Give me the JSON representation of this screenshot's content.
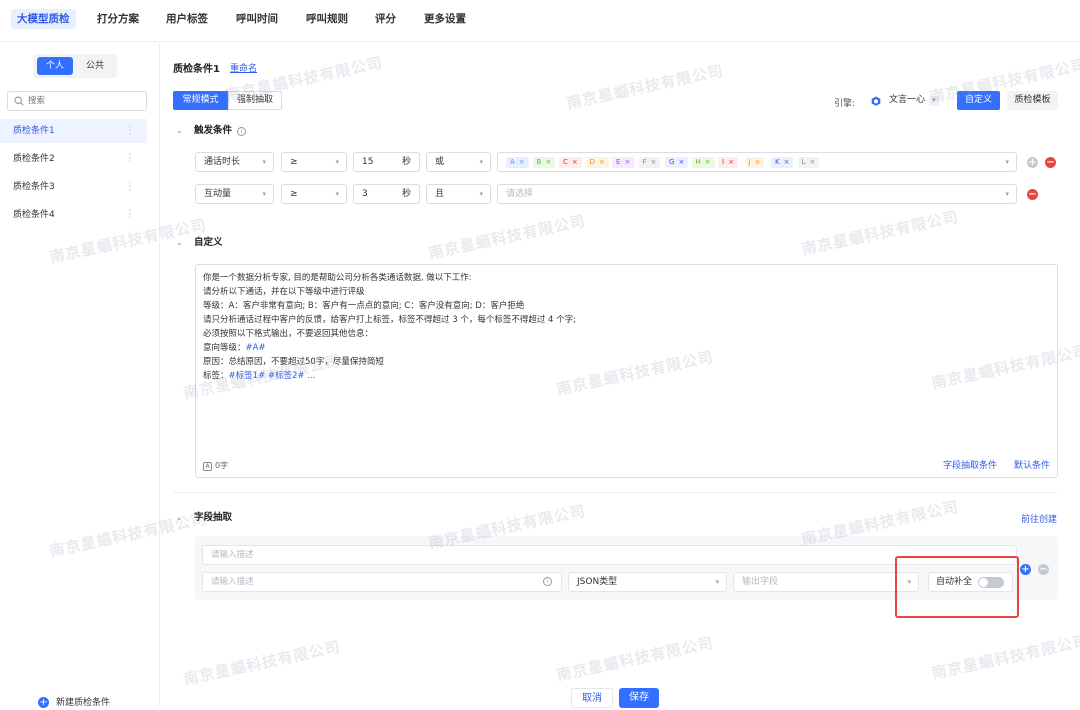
{
  "nav": {
    "tabs": [
      "大模型质检",
      "打分方案",
      "用户标签",
      "呼叫时间",
      "呼叫规则",
      "评分",
      "更多设置"
    ],
    "active": "大模型质检"
  },
  "sidebar": {
    "segments": [
      "个人",
      "公共"
    ],
    "active_segment": "个人",
    "search_placeholder": "搜索",
    "items": [
      {
        "label": "质检条件1",
        "more": "⋮"
      },
      {
        "label": "质检条件2",
        "more": "⋮"
      },
      {
        "label": "质检条件3",
        "more": "⋮"
      },
      {
        "label": "质检条件4",
        "more": "⋮"
      }
    ],
    "active_item": "质检条件1",
    "new_button": "新建质检条件"
  },
  "main": {
    "title": "质检条件1",
    "rename": "重命名",
    "modes": [
      "常规模式",
      "强制抽取"
    ],
    "active_mode": "常规模式",
    "engine_label": "引擎:",
    "engine_value": "文言一心",
    "custom_button": "自定义",
    "template_button": "质检模板"
  },
  "trigger": {
    "title": "触发条件",
    "rows": [
      {
        "field": "通话时长",
        "op": "≥",
        "value": "15",
        "unit": "秒",
        "logic": "或",
        "tags": [
          {
            "label": "A",
            "color": "#5b8ff9",
            "bg": "#e8f0ff"
          },
          {
            "label": "B",
            "color": "#52c41a",
            "bg": "#eaf8e4"
          },
          {
            "label": "C",
            "color": "#f5222d",
            "bg": "#ffecec"
          },
          {
            "label": "D",
            "color": "#fa8c16",
            "bg": "#fff3e3"
          },
          {
            "label": "E",
            "color": "#9254de",
            "bg": "#f3ecff"
          },
          {
            "label": "F",
            "color": "#8c8c8c",
            "bg": "#f2f2f2"
          },
          {
            "label": "G",
            "color": "#2f54eb",
            "bg": "#ebefff"
          },
          {
            "label": "H",
            "color": "#52c41a",
            "bg": "#eaf8e4"
          },
          {
            "label": "I",
            "color": "#f5222d",
            "bg": "#ffecec"
          },
          {
            "label": "J",
            "color": "#fa8c16",
            "bg": "#fff3e3"
          },
          {
            "label": "K",
            "color": "#2f54eb",
            "bg": "#ebefff"
          },
          {
            "label": "L",
            "color": "#8c8c8c",
            "bg": "#f2f2f2"
          }
        ],
        "placeholder": ""
      },
      {
        "field": "互动量",
        "op": "≥",
        "value": "3",
        "unit": "秒",
        "logic": "且",
        "tags": [],
        "placeholder": "请选择"
      }
    ]
  },
  "custom": {
    "title": "自定义",
    "prompt_lines": [
      {
        "text": "你是一个数据分析专家, 目的是帮助公司分析各类通话数据, 做以下工作:",
        "hl": ""
      },
      {
        "text": "请分析以下通话，并在以下等级中进行评级",
        "hl": ""
      },
      {
        "text": "等级：A：客户非常有意向; B：客户有一点点的意向; C：客户没有意向; D：客户拒绝",
        "hl": ""
      },
      {
        "text": "请只分析通话过程中客户的反馈，给客户打上标签，标签不得超过 3 个，每个标签不得超过 4 个字;",
        "hl": ""
      },
      {
        "text": "必须按照以下格式输出，不要返回其他信息：",
        "hl": ""
      },
      {
        "text": "意向等级：",
        "hl": "#A#"
      },
      {
        "text": "原因：总结原因，不要超过50字，尽量保持简短",
        "hl": ""
      },
      {
        "text": "标签：",
        "hl": "#标签1# #标签2# ..."
      }
    ],
    "count": "0字",
    "link_extract": "字段抽取条件",
    "link_default": "默认条件"
  },
  "field_extract": {
    "title": "字段抽取",
    "goto_create": "前往创建",
    "desc_placeholder_1": "请输入描述",
    "desc_placeholder_2": "请输入描述",
    "type_value": "JSON类型",
    "output_placeholder": "输出字段",
    "autofill_label": "自动补全",
    "autofill_on": false
  },
  "footer": {
    "cancel": "取消",
    "save": "保存"
  },
  "watermark": "南京星蝠科技有限公司",
  "colors": {
    "primary": "#3370ff",
    "danger": "#e8453c",
    "highlight_box": "#e8453c"
  }
}
